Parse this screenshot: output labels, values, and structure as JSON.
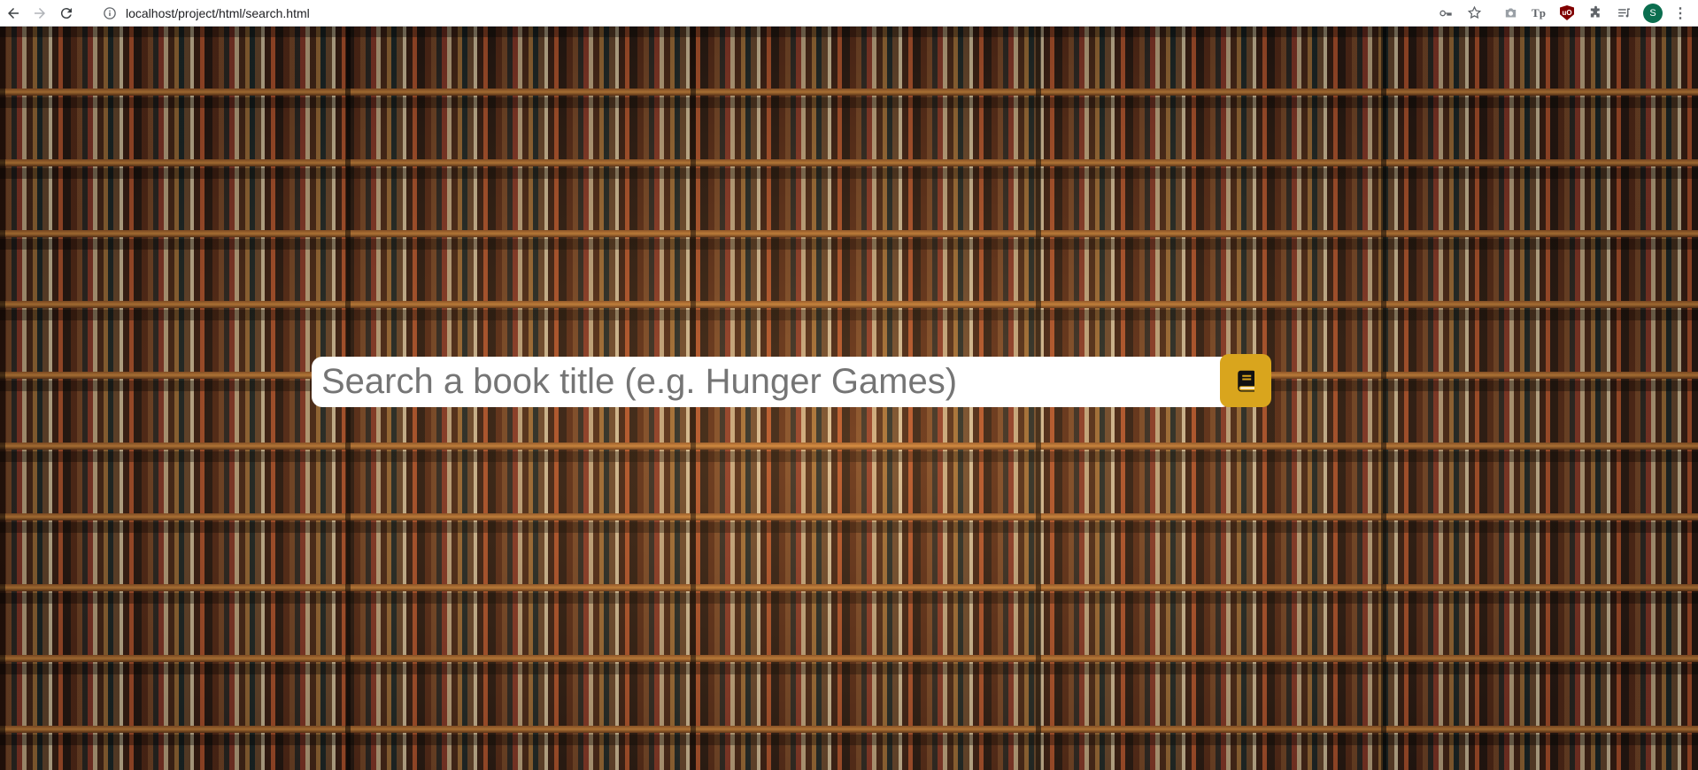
{
  "browser": {
    "url": "localhost/project/html/search.html",
    "avatar_letter": "S",
    "extension_tp_label": "Tp",
    "extension_ublock_label": "uO"
  },
  "search": {
    "placeholder": "Search a book title (e.g. Hunger Games)",
    "value": "",
    "button_icon": "book-icon",
    "button_color": "#d9a51d"
  },
  "background": {
    "image": "bookshelf"
  }
}
